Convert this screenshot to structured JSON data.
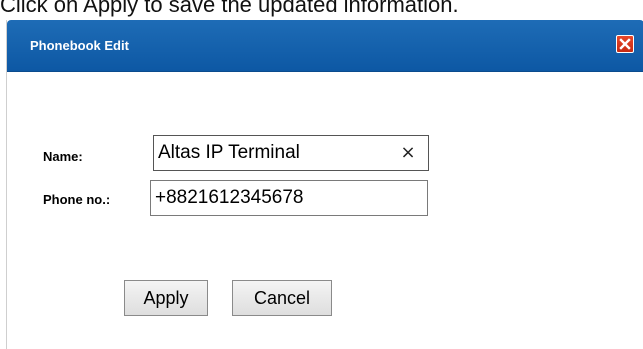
{
  "instruction": "Click on Apply to save the updated information.",
  "dialog": {
    "title": "Phonebook Edit",
    "close_icon": "close-icon",
    "accent_color": "#0d58a4",
    "close_color": "#d2351a"
  },
  "form": {
    "name_label": "Name:",
    "name_value": "Altas IP Terminal",
    "clear_glyph": "×",
    "phone_label": "Phone no.:",
    "phone_value": "+8821612345678"
  },
  "buttons": {
    "apply_label": "Apply",
    "cancel_label": "Cancel"
  }
}
